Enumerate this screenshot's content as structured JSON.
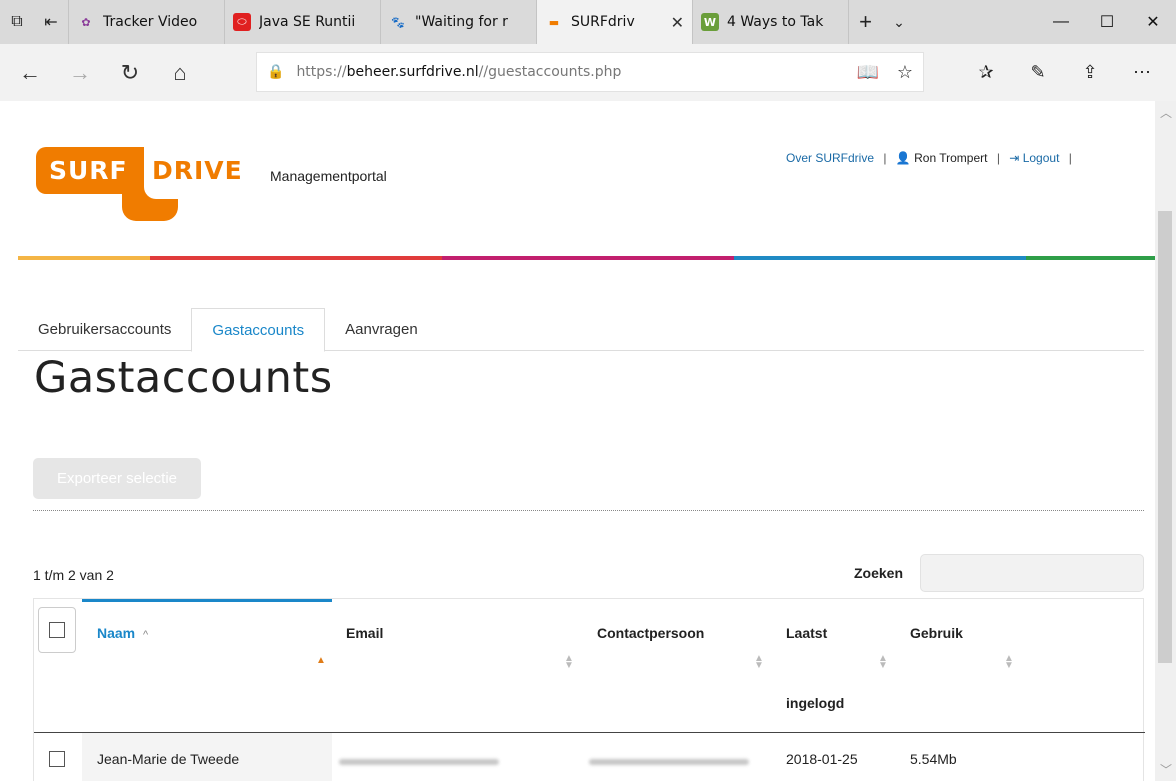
{
  "browser": {
    "tabs": [
      {
        "title": "Tracker Video",
        "active": false
      },
      {
        "title": "Java SE Runtii",
        "active": false
      },
      {
        "title": "\"Waiting for r",
        "active": false
      },
      {
        "title": "SURFdriv",
        "active": true
      },
      {
        "title": "4 Ways to Tak",
        "active": false
      }
    ],
    "url_scheme": "https://",
    "url_host": "beheer.surfdrive.nl",
    "url_path": "//guestaccounts.php"
  },
  "header": {
    "logo_left": "SURF",
    "logo_right": "DRIVE",
    "portal_label": "Managementportal",
    "about_link": "Over SURFdrive",
    "user_name": "Ron Trompert",
    "logout_link": "Logout",
    "separator": "|",
    "colors": [
      "#f4b545",
      "#e03b3b",
      "#c21f6e",
      "#1f8ac4",
      "#1f8ac4",
      "#2e9e48"
    ]
  },
  "nav_tabs": [
    {
      "label": "Gebruikersaccounts",
      "active": false
    },
    {
      "label": "Gastaccounts",
      "active": true
    },
    {
      "label": "Aanvragen",
      "active": false
    }
  ],
  "main": {
    "page_title": "Gastaccounts",
    "export_button": "Exporteer selectie",
    "record_count": "1 t/m 2 van 2",
    "search_label": "Zoeken",
    "search_value": ""
  },
  "table": {
    "columns": [
      {
        "label": "Naam",
        "sort": "asc"
      },
      {
        "label": "Email",
        "sort": "none"
      },
      {
        "label": "Contactpersoon",
        "sort": "none"
      },
      {
        "label_line1": "Laatst",
        "label_line2": "ingelogd",
        "sort": "none"
      },
      {
        "label": "Gebruik",
        "sort": "none"
      }
    ],
    "rows": [
      {
        "name": "Jean-Marie de Tweede",
        "email": "",
        "contact": "",
        "last_login": "2018-01-25",
        "usage": "5.54Mb"
      }
    ]
  }
}
